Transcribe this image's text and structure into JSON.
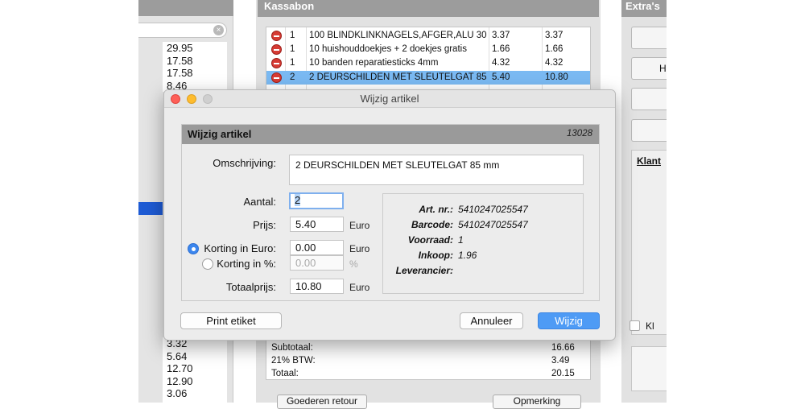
{
  "left_panel": {
    "prices_top": [
      "29.95",
      "17.58",
      "17.58",
      "8.46"
    ],
    "prices_bottom": [
      "3.32",
      "5.64",
      "12.70",
      "12.90",
      "3.06"
    ]
  },
  "kassabon": {
    "title": "Kassabon",
    "rows": [
      {
        "qty": "1",
        "desc": "100 BLINDKLINKNAGELS,AFGER,ALU 30",
        "price": "3.37",
        "total": "3.37"
      },
      {
        "qty": "1",
        "desc": "10 huishouddoekjes + 2 doekjes gratis",
        "price": "1.66",
        "total": "1.66"
      },
      {
        "qty": "1",
        "desc": "10 banden reparatiesticks 4mm",
        "price": "4.32",
        "total": "4.32"
      },
      {
        "qty": "2",
        "desc": "2 DEURSCHILDEN MET SLEUTELGAT 85",
        "price": "5.40",
        "total": "10.80"
      }
    ],
    "totals": [
      {
        "label": "Subtotaal:",
        "value": "16.66"
      },
      {
        "label": "21% BTW:",
        "value": "3.49"
      },
      {
        "label": "Totaal:",
        "value": "20.15"
      }
    ],
    "goederen_retour": "Goederen retour",
    "opmerking": "Opmerking"
  },
  "extras": {
    "title": "Extra's",
    "button_h_label": "H",
    "klant_title": "Klant",
    "klant_checkbox_label": "Kla"
  },
  "dialog": {
    "window_title": "Wijzig artikel",
    "panel_title": "Wijzig artikel",
    "article_id": "13028",
    "omschrijving_label": "Omschrijving:",
    "omschrijving_value": "2 DEURSCHILDEN MET SLEUTELGAT 85 mm",
    "aantal_label": "Aantal:",
    "aantal_value": "2",
    "prijs_label": "Prijs:",
    "prijs_value": "5.40",
    "korting_euro_label": "Korting in Euro:",
    "korting_euro_value": "0.00",
    "korting_pct_label": "Korting in %:",
    "korting_pct_value": "0.00",
    "totaalprijs_label": "Totaalprijs:",
    "totaalprijs_value": "10.80",
    "unit_euro": "Euro",
    "unit_pct": "%",
    "info": [
      {
        "key": "Art. nr.:",
        "value": "5410247025547"
      },
      {
        "key": "Barcode:",
        "value": "5410247025547"
      },
      {
        "key": "Voorraad:",
        "value": "1"
      },
      {
        "key": "Inkoop:",
        "value": "1.96"
      },
      {
        "key": "Leverancier:",
        "value": ""
      }
    ],
    "print_button": "Print etiket",
    "cancel_button": "Annuleer",
    "confirm_button": "Wijzig"
  },
  "colors": {
    "accent": "#4e9bf5",
    "selection": "#7ab9f2",
    "header_gray": "#9c9c9c",
    "delete_red": "#d63b34"
  }
}
